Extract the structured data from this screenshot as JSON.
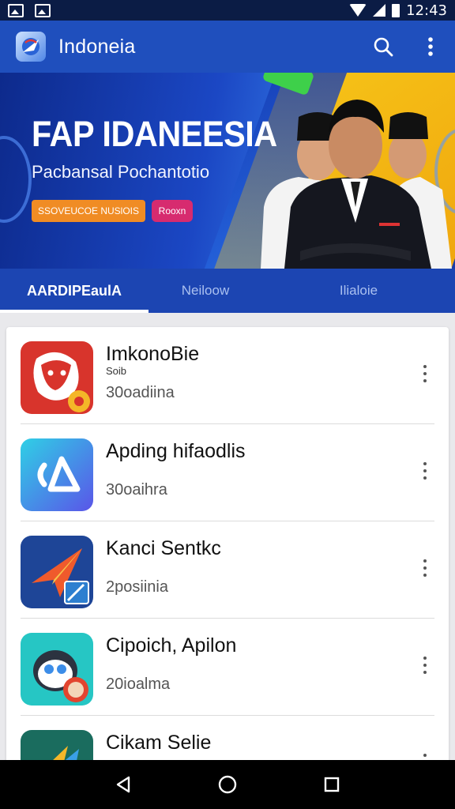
{
  "status_bar": {
    "time": "12:43"
  },
  "app_bar": {
    "title": "Indoneia"
  },
  "banner": {
    "title": "FAP IDANEESIA",
    "subtitle": "Pacbansal Pochantotio",
    "primary_button": "SSOVEUCOE NUSlOIS",
    "secondary_button": "Rooxn"
  },
  "tabs": [
    {
      "label": "AARDIPEaulA",
      "active": true
    },
    {
      "label": "Neiloow",
      "active": false
    },
    {
      "label": "Ilialoie",
      "active": false
    }
  ],
  "apps": [
    {
      "name": "ImkonoBie",
      "sub": "Soib",
      "count": "30oadiina",
      "icon": "red-face-icon"
    },
    {
      "name": "Apding hifaodlis",
      "sub": "",
      "count": "30oaihra",
      "icon": "gradient-triangle-icon"
    },
    {
      "name": "Kanci Sentkc",
      "sub": "",
      "count": "2posiinia",
      "icon": "paper-plane-icon"
    },
    {
      "name": "Cipoich, Apilon",
      "sub": "",
      "count": "20ioalma",
      "icon": "robot-face-icon"
    },
    {
      "name": "Cikam Selie",
      "sub": "",
      "count": "",
      "icon": "arrow-logo-icon"
    }
  ],
  "colors": {
    "app_bar": "#1f4fbd",
    "tabs": "#1c45b2",
    "accent_orange": "#f08c24",
    "accent_pink": "#d72b6f"
  }
}
